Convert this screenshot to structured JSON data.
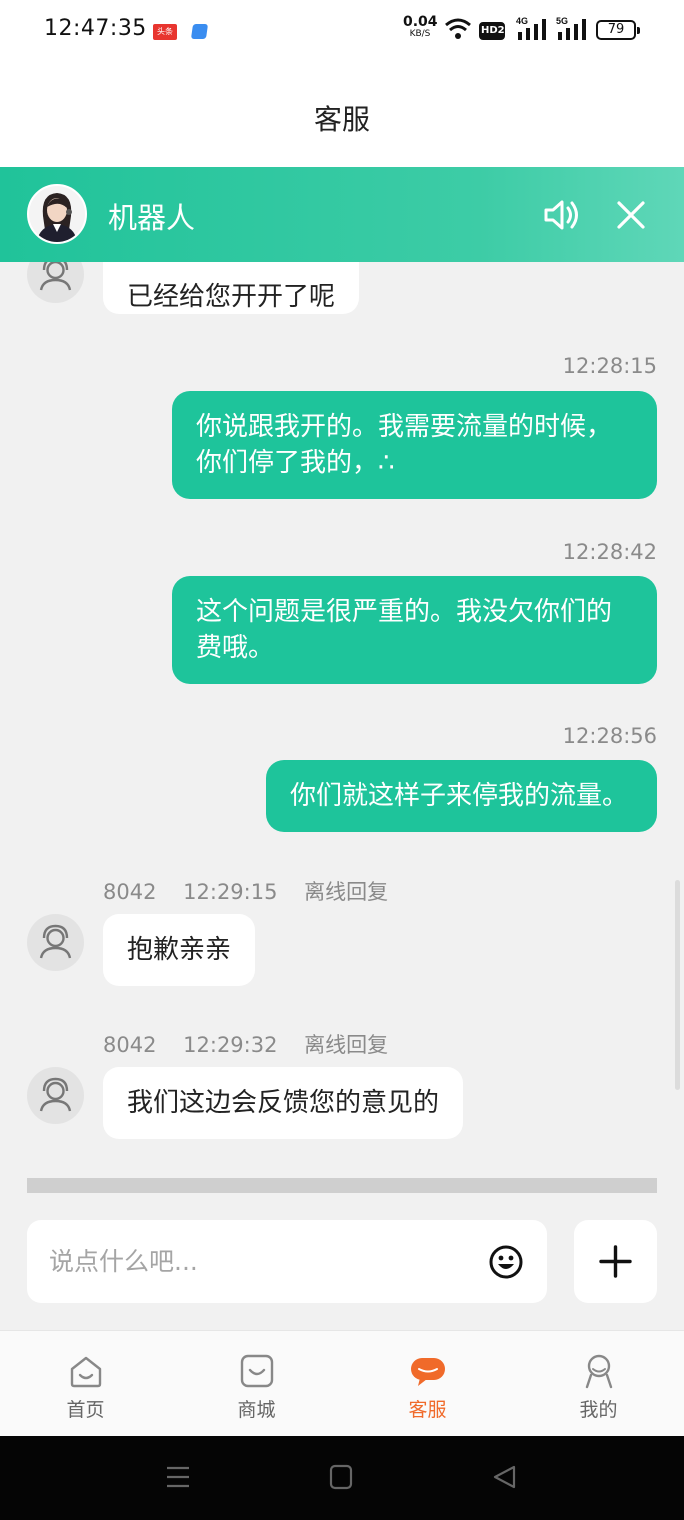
{
  "status_bar": {
    "time": "12:47:35",
    "notification_badge": "头条",
    "net_speed_value": "0.04",
    "net_speed_unit": "KB/S",
    "hd_label": "HD2",
    "signal_1_label": "4G",
    "signal_2_label": "5G",
    "battery": "79"
  },
  "header": {
    "title": "客服"
  },
  "robot_bar": {
    "name": "机器人"
  },
  "messages": [
    {
      "from": "agent",
      "text": "已经给您开开了呢"
    },
    {
      "from": "user",
      "time": "12:28:15",
      "lines": [
        "你说跟我开的。我需要流量的时候，",
        "你们停了我的，∴"
      ]
    },
    {
      "from": "user",
      "time": "12:28:42",
      "lines": [
        "这个问题是很严重的。我没欠你们的",
        "费哦。"
      ]
    },
    {
      "from": "user",
      "time": "12:28:56",
      "lines": [
        "你们就这样子来停我的流量。"
      ]
    },
    {
      "from": "agent",
      "agent_id": "8042",
      "time": "12:29:15",
      "status": "离线回复",
      "text": "抱歉亲亲"
    },
    {
      "from": "agent",
      "agent_id": "8042",
      "time": "12:29:32",
      "status": "离线回复",
      "text": "我们这边会反馈您的意见的"
    }
  ],
  "input": {
    "placeholder": "说点什么吧..."
  },
  "tabs": [
    {
      "label": "首页",
      "icon": "home-icon"
    },
    {
      "label": "商城",
      "icon": "shop-icon"
    },
    {
      "label": "客服",
      "icon": "chat-bubble-icon",
      "active": true
    },
    {
      "label": "我的",
      "icon": "profile-icon"
    }
  ],
  "colors": {
    "accent_green": "#1ec49b",
    "active_tab": "#f06a2a",
    "background": "#f1f1f1"
  }
}
